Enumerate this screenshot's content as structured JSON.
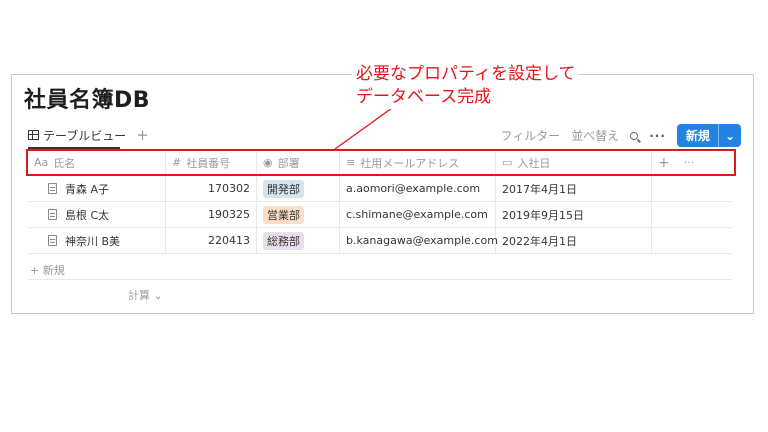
{
  "annotation": {
    "line1": "必要なプロパティを設定して",
    "line2": "データベース完成",
    "color": "#e0161b"
  },
  "database": {
    "title": "社員名簿DB"
  },
  "view": {
    "tab_label": "テーブルビュー",
    "add_view": "+"
  },
  "toolbar": {
    "filter": "フィルター",
    "sort": "並べ替え",
    "more": "···",
    "new_label": "新規",
    "new_chevron": "⌄",
    "accent": "#2383e2"
  },
  "columns": [
    {
      "icon": "Aa",
      "label": "氏名"
    },
    {
      "icon": "#",
      "label": "社員番号"
    },
    {
      "icon": "◉",
      "label": "部署"
    },
    {
      "icon": "≡",
      "label": "社用メールアドレス"
    },
    {
      "icon": "▭",
      "label": "入社日"
    }
  ],
  "column_actions": {
    "add": "+",
    "more": "···"
  },
  "rows": [
    {
      "name": "青森 A子",
      "number": "170302",
      "dept": "開発部",
      "dept_color": "#d3e5ef",
      "email": "a.aomori@example.com",
      "joined": "2017年4月1日"
    },
    {
      "name": "島根 C太",
      "number": "190325",
      "dept": "営業部",
      "dept_color": "#fadec9",
      "email": "c.shimane@example.com",
      "joined": "2019年9月15日"
    },
    {
      "name": "神奈川 B美",
      "number": "220413",
      "dept": "総務部",
      "dept_color": "#e8deee",
      "email": "b.kanagawa@example.com",
      "joined": "2022年4月1日"
    }
  ],
  "add_row_label": "+ 新規",
  "calc_label": "計算 ⌄"
}
